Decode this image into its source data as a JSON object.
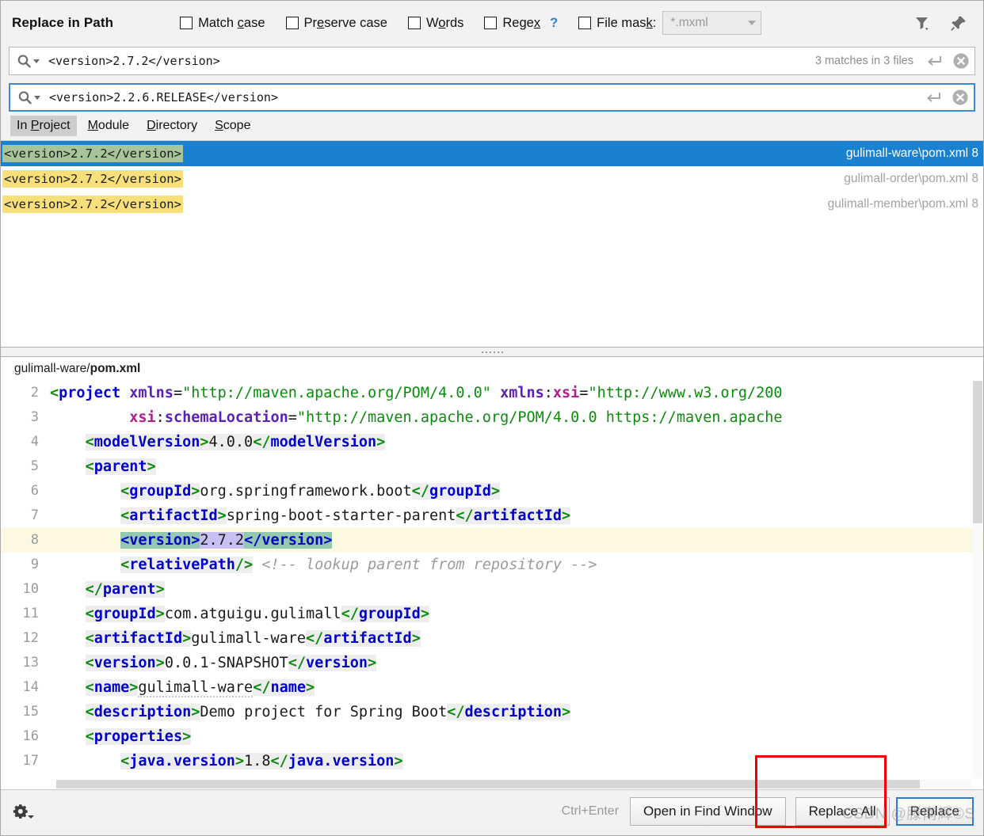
{
  "dialog": {
    "title": "Replace in Path"
  },
  "options": {
    "match_case": {
      "label_pre": "Match ",
      "mnemonic": "c",
      "label_post": "ase",
      "checked": false
    },
    "preserve_case": {
      "label_pre": "Pr",
      "mnemonic": "e",
      "label_post": "serve case",
      "checked": false
    },
    "words": {
      "label_pre": "W",
      "mnemonic": "o",
      "label_post": "rds",
      "checked": false
    },
    "regex": {
      "label_pre": "Rege",
      "mnemonic": "x",
      "label_post": "",
      "checked": false,
      "help": "?"
    },
    "file_mask": {
      "label_pre": "File mas",
      "mnemonic": "k",
      "label_post": ":",
      "checked": false,
      "value": "*.mxml"
    }
  },
  "header_icons": {
    "filter": "filter-icon",
    "pin": "pin-icon"
  },
  "search": {
    "value": "<version>2.7.2</version>",
    "matches_text": "3 matches in 3 files",
    "icon": "search-icon",
    "enter_icon": "enter-icon",
    "clear_icon": "clear-icon"
  },
  "replace": {
    "value": "<version>2.2.6.RELEASE</version>",
    "icon": "search-icon",
    "enter_icon": "enter-icon",
    "clear_icon": "clear-icon"
  },
  "scope_tabs": [
    {
      "pre": "In ",
      "mnemonic": "P",
      "post": "roject",
      "active": true
    },
    {
      "pre": "",
      "mnemonic": "M",
      "post": "odule",
      "active": false
    },
    {
      "pre": "",
      "mnemonic": "D",
      "post": "irectory",
      "active": false
    },
    {
      "pre": "",
      "mnemonic": "S",
      "post": "cope",
      "active": false
    }
  ],
  "results": [
    {
      "match": "<version>2.7.2</version>",
      "path": "gulimall-ware\\pom.xml 8",
      "selected": true
    },
    {
      "match": "<version>2.7.2</version>",
      "path": "gulimall-order\\pom.xml 8",
      "selected": false
    },
    {
      "match": "<version>2.7.2</version>",
      "path": "gulimall-member\\pom.xml 8",
      "selected": false
    }
  ],
  "preview": {
    "file_dir": "gulimall-ware/",
    "file_name": "pom.xml",
    "lines": [
      {
        "n": "2",
        "text": "<project xmlns=\"http://maven.apache.org/POM/4.0.0\" xmlns:xsi=\"http://www.w3.org/200"
      },
      {
        "n": "3",
        "text": "         xsi:schemaLocation=\"http://maven.apache.org/POM/4.0.0 https://maven.apache"
      },
      {
        "n": "4",
        "text": "    <modelVersion>4.0.0</modelVersion>"
      },
      {
        "n": "5",
        "text": "    <parent>"
      },
      {
        "n": "6",
        "text": "        <groupId>org.springframework.boot</groupId>"
      },
      {
        "n": "7",
        "text": "        <artifactId>spring-boot-starter-parent</artifactId>"
      },
      {
        "n": "8",
        "text": "        <version>2.7.2</version>",
        "highlighted": true
      },
      {
        "n": "9",
        "text": "        <relativePath/> <!-- lookup parent from repository -->"
      },
      {
        "n": "10",
        "text": "    </parent>"
      },
      {
        "n": "11",
        "text": "    <groupId>com.atguigu.gulimall</groupId>"
      },
      {
        "n": "12",
        "text": "    <artifactId>gulimall-ware</artifactId>"
      },
      {
        "n": "13",
        "text": "    <version>0.0.1-SNAPSHOT</version>"
      },
      {
        "n": "14",
        "text": "    <name>gulimall-ware</name>"
      },
      {
        "n": "15",
        "text": "    <description>Demo project for Spring Boot</description>"
      },
      {
        "n": "16",
        "text": "    <properties>"
      },
      {
        "n": "17",
        "text": "        <java.version>1.8</java.version>"
      }
    ]
  },
  "bottom": {
    "settings_icon": "gear-icon",
    "shortcut": "Ctrl+Enter",
    "open_in_find_window": "Open in Find Window",
    "replace_all": "Replace All",
    "replace_all_mnemonic": "A",
    "replace": "Replace"
  },
  "watermark": {
    "text": "CSDN @滕南辉©S"
  },
  "colors": {
    "selection_blue": "#1a81d1",
    "match_yellow": "#f7df7a",
    "focus_blue": "#3b8ada",
    "annotation_red": "#f40000",
    "hl_line": "#fdf8e2",
    "hit_tag_green": "#93c8b1",
    "hit_value_lavender": "#c8c0f0"
  }
}
